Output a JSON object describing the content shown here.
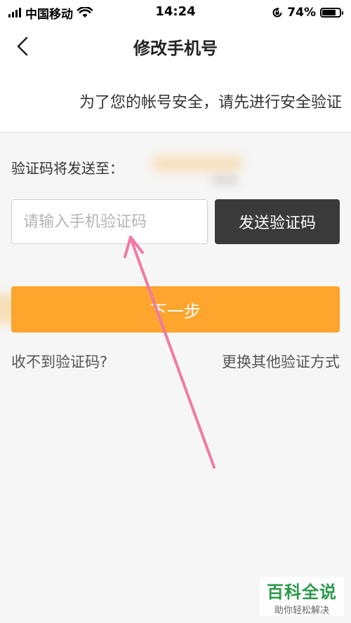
{
  "status_bar": {
    "carrier": "中国移动",
    "time": "14:24",
    "battery_percent": "74%",
    "battery_level": 0.74
  },
  "nav": {
    "title": "修改手机号",
    "back_icon": "chevron-left-icon"
  },
  "notice": {
    "text": "为了您的帐号安全，请先进行安全验证"
  },
  "form": {
    "send_to_label": "验证码将发送至：",
    "code_input": {
      "placeholder": "请输入手机验证码",
      "value": ""
    },
    "send_code_label": "发送验证码",
    "next_label": "下一步"
  },
  "links": {
    "no_code": "收不到验证码?",
    "other_method": "更换其他验证方式"
  },
  "watermark": {
    "title": "百科全说",
    "subtitle": "助你轻松解决"
  },
  "colors": {
    "accent_orange": "#fda52d",
    "dark_button": "#3a3a3a",
    "arrow_pink": "#f07aa0",
    "watermark_green": "#2a9a4a"
  }
}
